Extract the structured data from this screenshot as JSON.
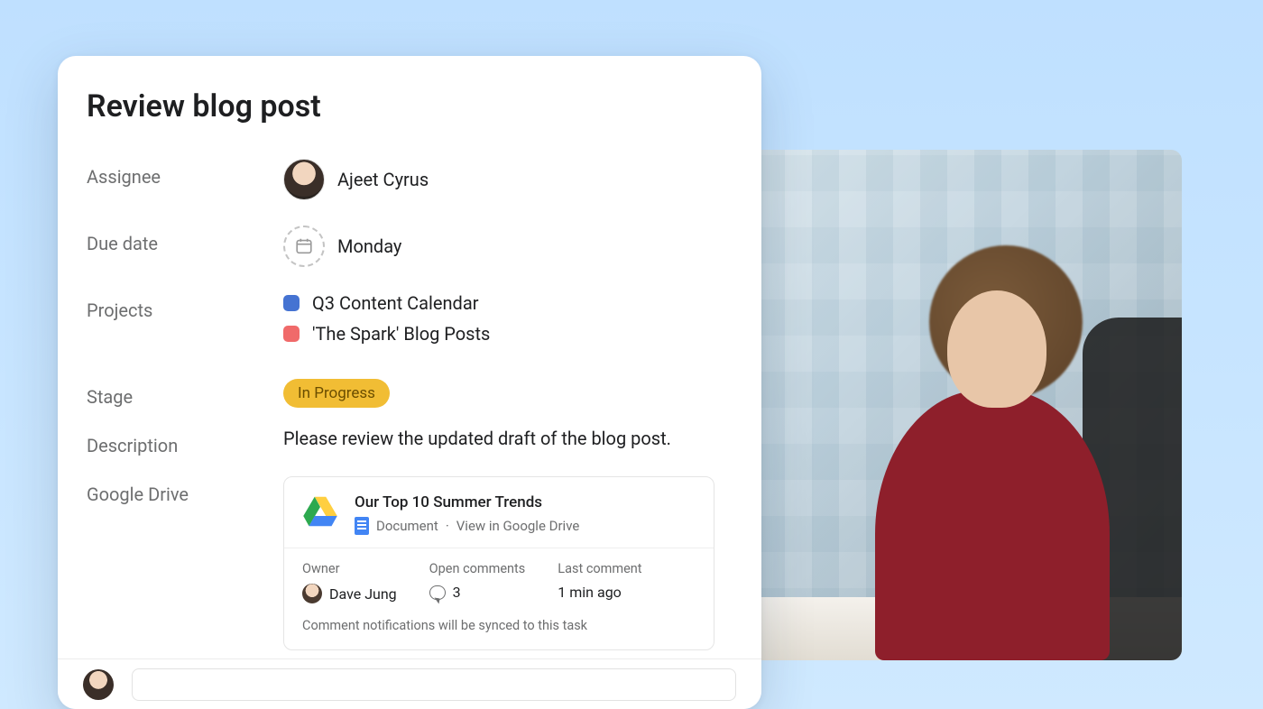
{
  "task": {
    "title": "Review blog post",
    "labels": {
      "assignee": "Assignee",
      "due_date": "Due date",
      "projects": "Projects",
      "stage": "Stage",
      "description": "Description",
      "google_drive": "Google Drive"
    },
    "assignee": {
      "name": "Ajeet Cyrus"
    },
    "due_date": "Monday",
    "projects": [
      {
        "color": "blue",
        "name": "Q3 Content Calendar"
      },
      {
        "color": "red",
        "name": "'The Spark' Blog Posts"
      }
    ],
    "stage": {
      "label": "In Progress",
      "color": "#f1bd34"
    },
    "description": "Please review the updated draft of the blog post."
  },
  "drive": {
    "title": "Our Top 10 Summer Trends",
    "type_label": "Document",
    "view_link_label": "View in Google Drive",
    "meta": {
      "owner_label": "Owner",
      "owner_name": "Dave Jung",
      "open_comments_label": "Open comments",
      "open_comments_count": "3",
      "last_comment_label": "Last comment",
      "last_comment_value": "1 min ago"
    },
    "sync_note": "Comment notifications will be synced to this task"
  }
}
